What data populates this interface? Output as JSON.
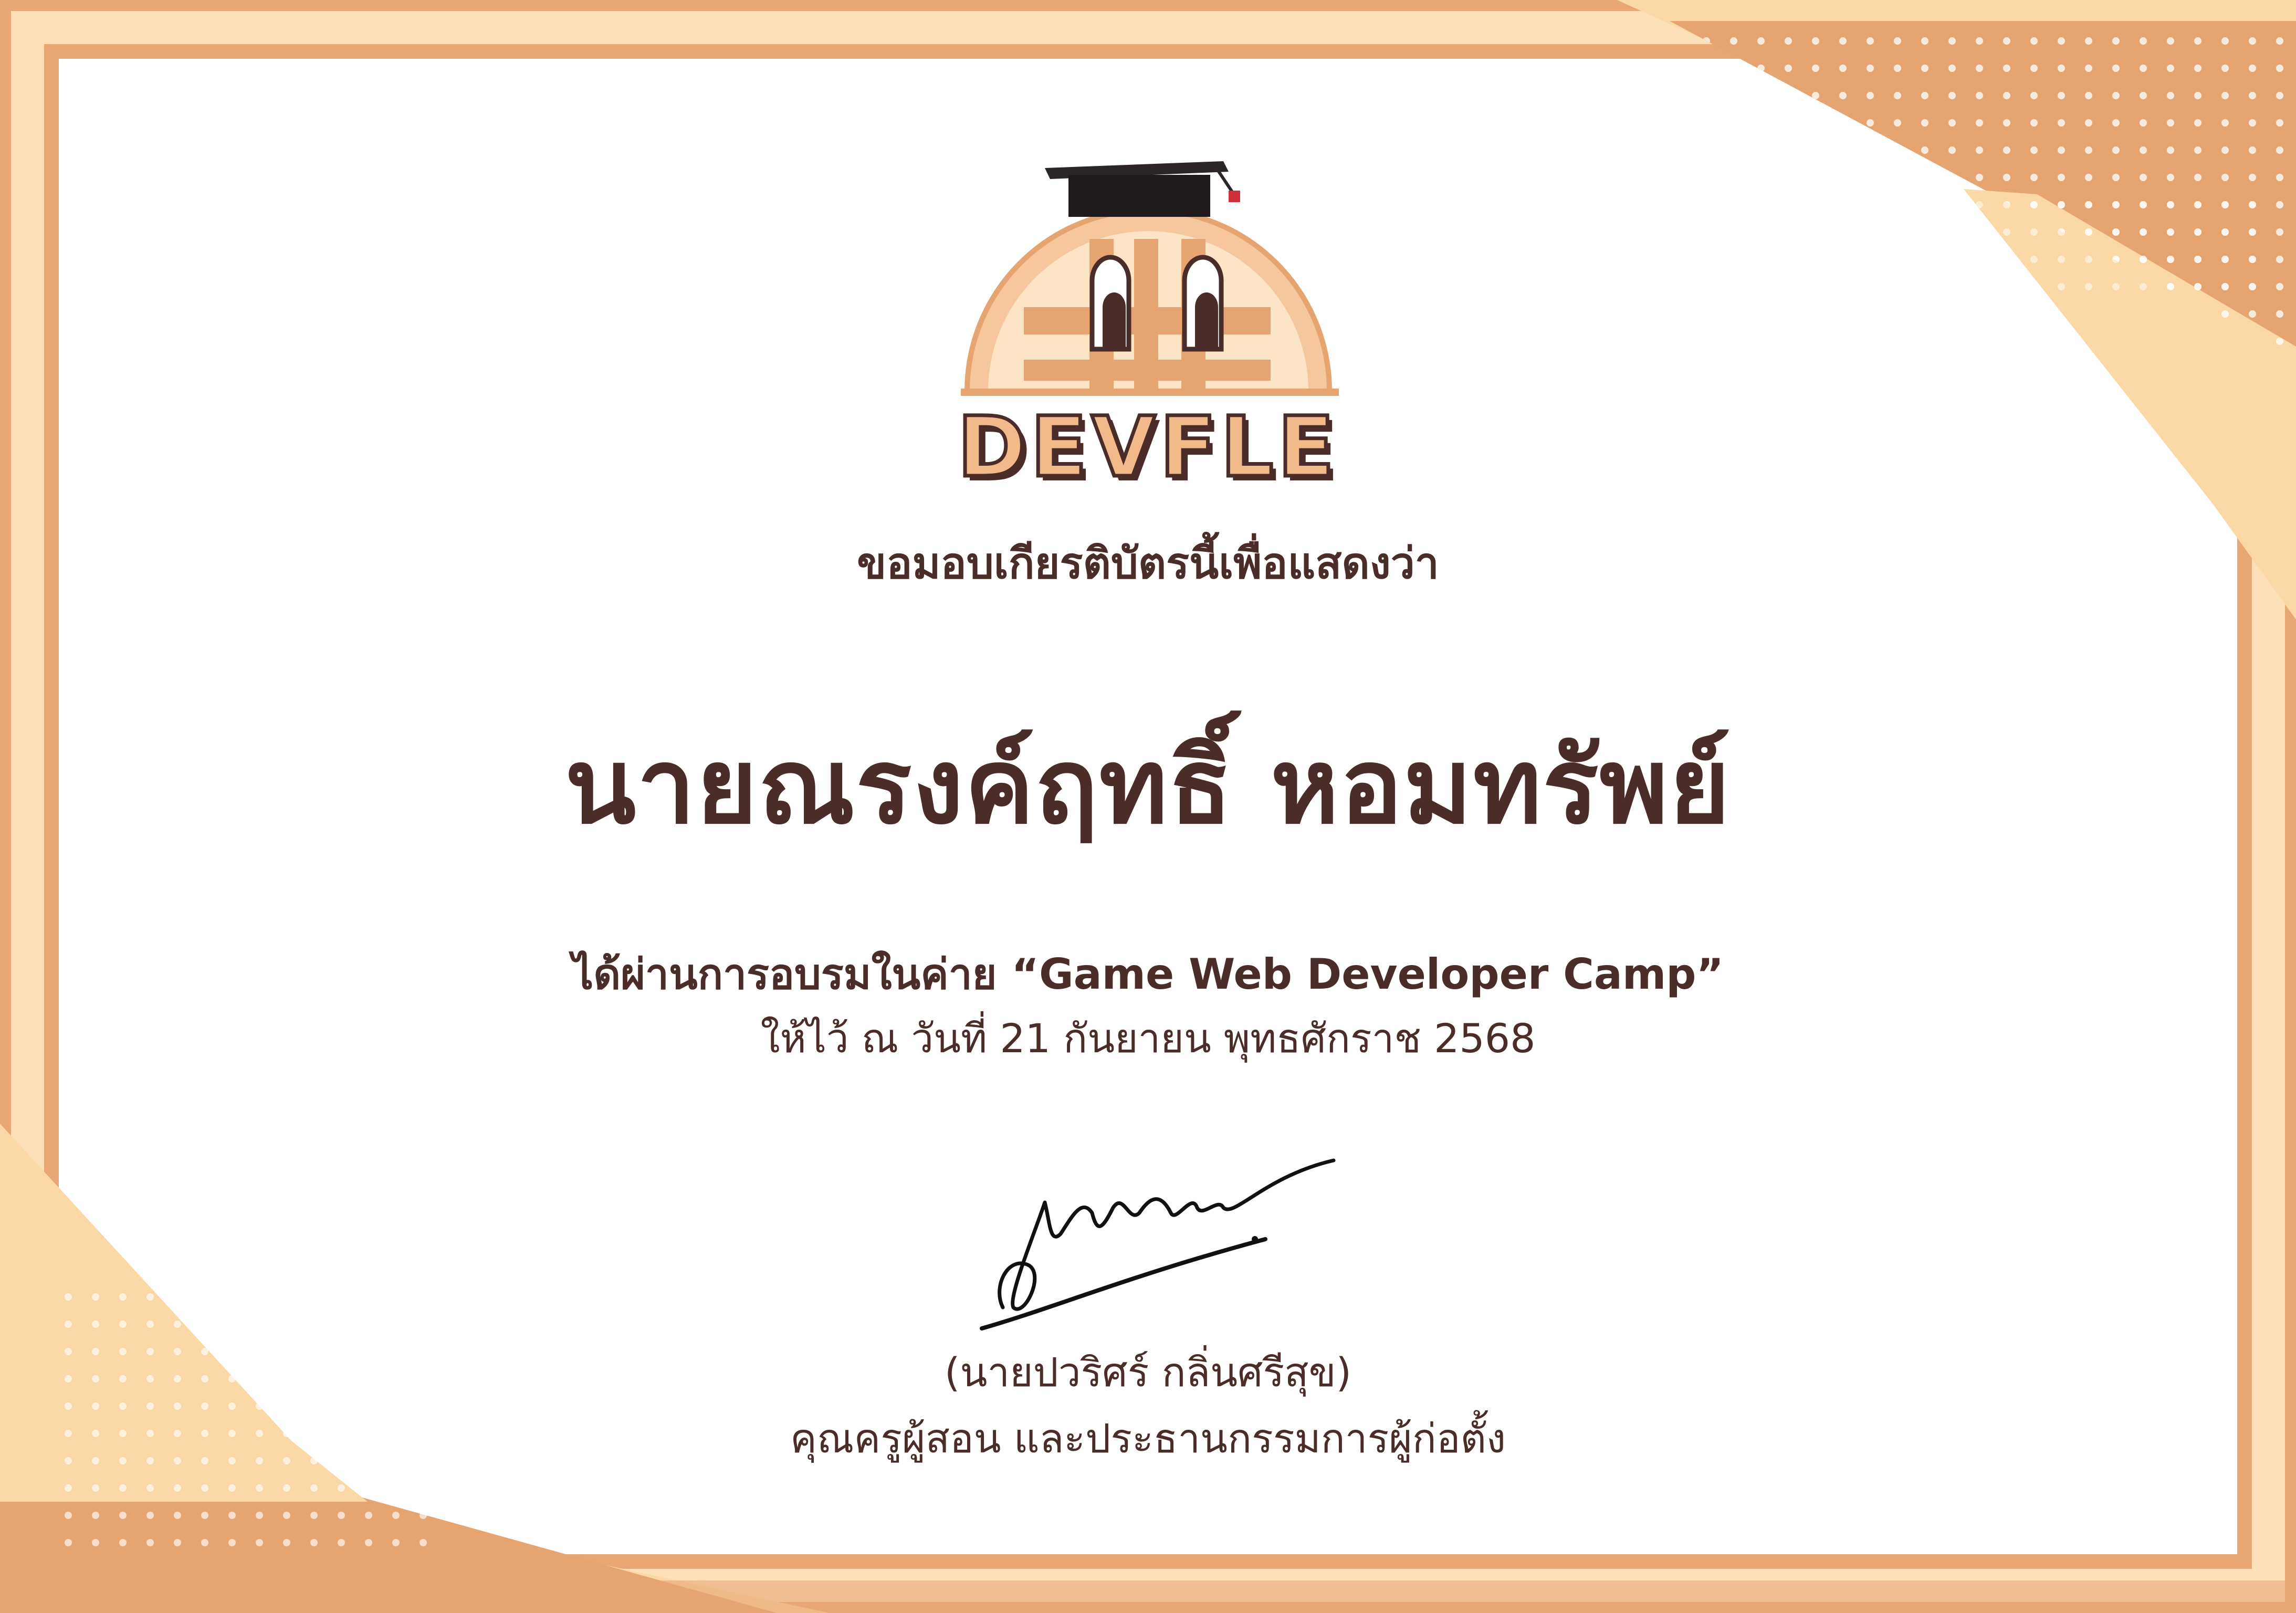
{
  "brand": {
    "name": "DEVFLE"
  },
  "certificate": {
    "intro": "ขอมอบเกียรติบัตรนี้เพื่อแสดงว่า",
    "recipient": "นายณรงค์ฤทธิ์ หอมทรัพย์",
    "course_line": "ได้ผ่านการอบรมในค่าย “Game Web Developer Camp”",
    "date_line": "ให้ไว้ ณ วันที่ 21 กันยายน พุทธศักราช 2568"
  },
  "signatory": {
    "name": "(นายปวริศร์ กลิ่นศรีสุข)",
    "title": "คุณครูผู้สอน และประธานกรรมการผู้ก่อตั้ง"
  },
  "colors": {
    "text": "#4a2c28",
    "border_outer": "#e8a774",
    "border_inner": "#fde0b8",
    "accent_dark": "#e6a470",
    "accent_light": "#fcd8a6",
    "logo_fill": "#f2b98a"
  },
  "icons": [
    "graduation-cap-icon",
    "window-eyes-icon",
    "signature-mark"
  ]
}
